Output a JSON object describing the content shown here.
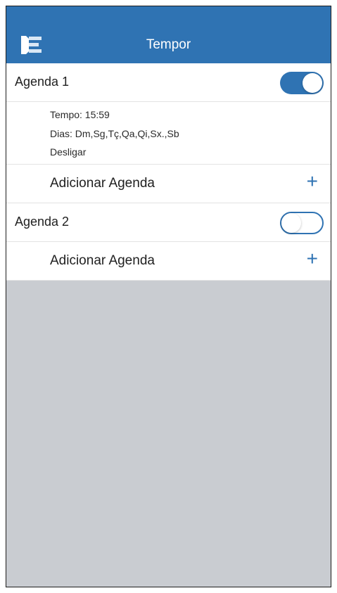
{
  "nav": {
    "title": "Tempor",
    "menu_icon": "sidebar-menu-icon"
  },
  "agendas": [
    {
      "label": "Agenda 1",
      "enabled": true,
      "details": {
        "tempo": "Tempo: 15:59",
        "dias": "Dias: Dm,Sg,Tç,Qa,Qi,Sx.,Sb",
        "acao": "Desligar"
      },
      "add_label": "Adicionar Agenda",
      "add_symbol": "+"
    },
    {
      "label": "Agenda 2",
      "enabled": false,
      "add_label": "Adicionar Agenda",
      "add_symbol": "+"
    }
  ],
  "colors": {
    "accent": "#2f73b3",
    "background": "#c9ccd1"
  }
}
